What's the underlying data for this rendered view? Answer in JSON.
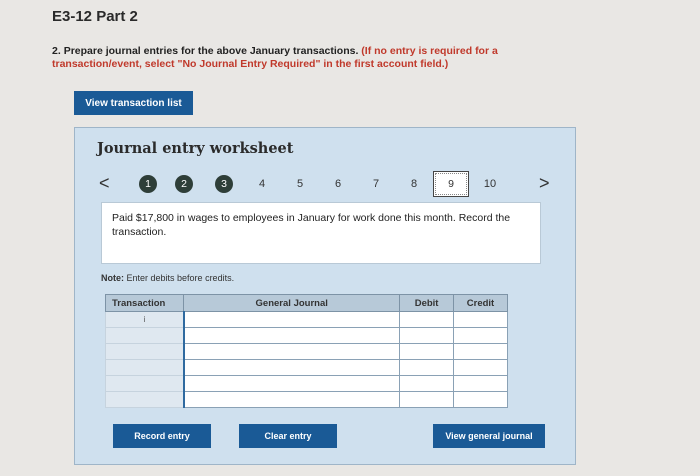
{
  "page": {
    "title": "E3-12 Part 2",
    "instruction": {
      "number": "2.",
      "text": "Prepare journal entries for the above January transactions.",
      "red_note": "(If no entry is required for a transaction/event, select \"No Journal Entry Required\" in the first account field.)"
    },
    "view_transaction_label": "View transaction list"
  },
  "worksheet": {
    "title": "Journal entry worksheet",
    "nav_prev": "<",
    "nav_next": ">",
    "steps": [
      "1",
      "2",
      "3",
      "4",
      "5",
      "6",
      "7",
      "8",
      "9",
      "10"
    ],
    "active_step": "9",
    "prompt": "Paid $17,800 in wages to employees in January for work done this month. Record the transaction.",
    "note_label": "Note:",
    "note_text": "Enter debits before credits.",
    "table": {
      "headers": {
        "transaction": "Transaction",
        "general_journal": "General Journal",
        "debit": "Debit",
        "credit": "Credit"
      },
      "first_row_transaction": "i",
      "row_count": 6
    },
    "buttons": {
      "record": "Record entry",
      "clear": "Clear entry",
      "view_journal": "View general journal"
    }
  },
  "colors": {
    "button_blue": "#1a5a96",
    "worksheet_bg": "#cfe0ee",
    "completed_step": "#2e3e38",
    "instruction_red": "#c0392b"
  }
}
